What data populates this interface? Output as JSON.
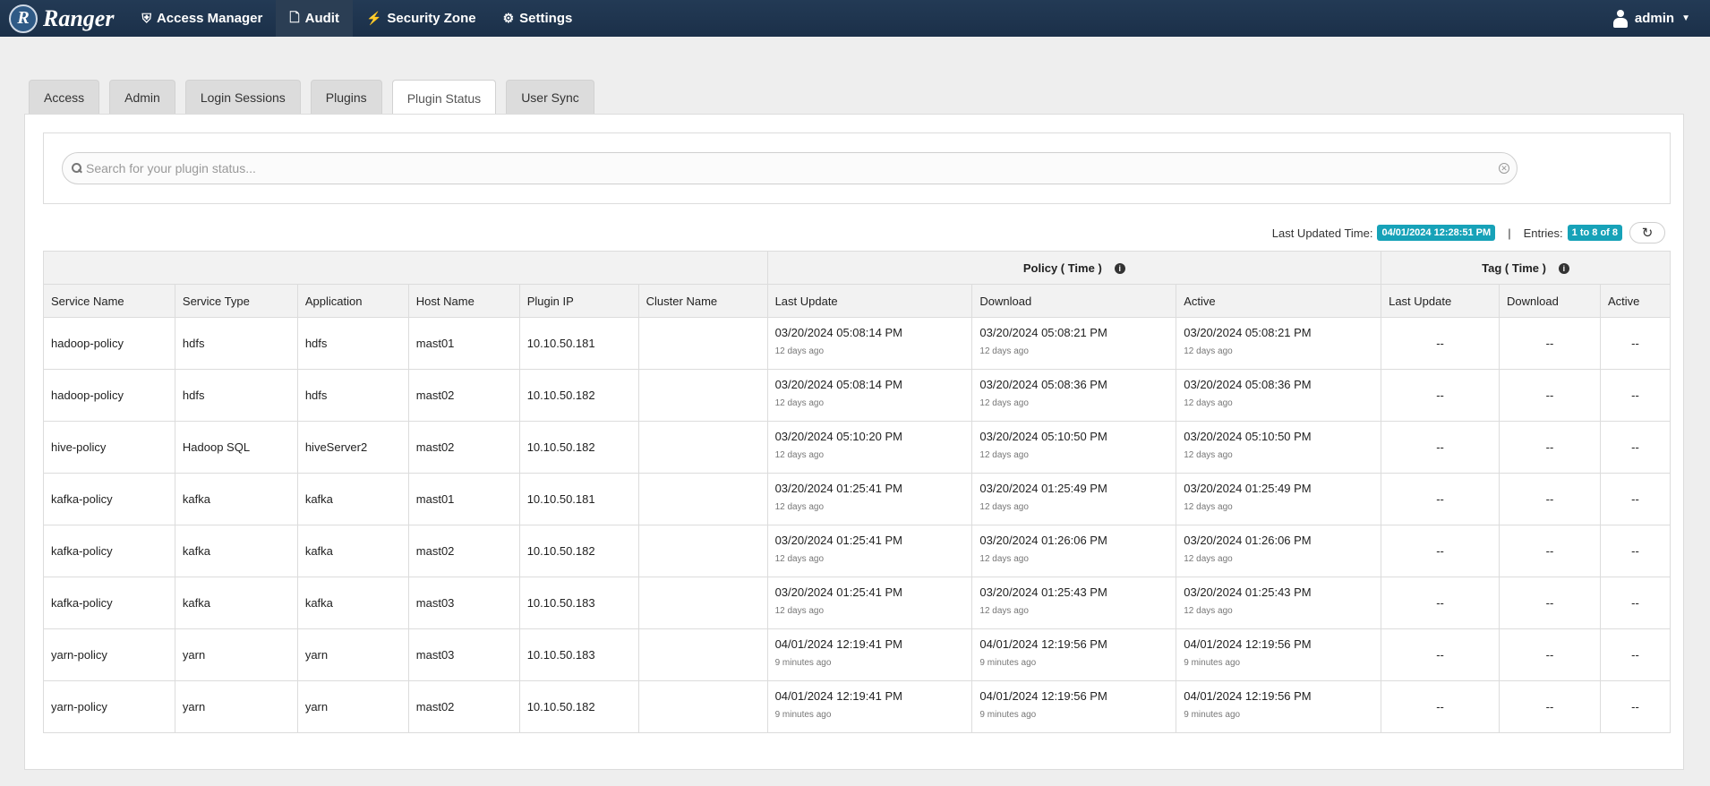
{
  "nav": {
    "brand": "Ranger",
    "brand_logo_letter": "R",
    "items": [
      {
        "label": "Access Manager",
        "icon": "shield-icon"
      },
      {
        "label": "Audit",
        "icon": "file-icon"
      },
      {
        "label": "Security Zone",
        "icon": "bolt-icon"
      },
      {
        "label": "Settings",
        "icon": "gear-icon"
      }
    ],
    "active_item": "Audit",
    "user": "admin"
  },
  "tabs": [
    "Access",
    "Admin",
    "Login Sessions",
    "Plugins",
    "Plugin Status",
    "User Sync"
  ],
  "active_tab": "Plugin Status",
  "search": {
    "placeholder": "Search for your plugin status..."
  },
  "status": {
    "last_updated_label": "Last Updated Time:",
    "last_updated_value": "04/01/2024 12:28:51 PM",
    "separator": "|",
    "entries_label": "Entries:",
    "entries_value": "1 to 8 of 8"
  },
  "table": {
    "group_headers": {
      "policy": "Policy ( Time )",
      "tag": "Tag ( Time )"
    },
    "columns": [
      "Service Name",
      "Service Type",
      "Application",
      "Host Name",
      "Plugin IP",
      "Cluster Name",
      "Last Update",
      "Download",
      "Active",
      "Last Update",
      "Download",
      "Active"
    ],
    "rows": [
      {
        "service_name": "hadoop-policy",
        "service_type": "hdfs",
        "application": "hdfs",
        "host_name": "mast01",
        "plugin_ip": "10.10.50.181",
        "cluster_name": "",
        "policy_last_update": "03/20/2024 05:08:14 PM",
        "policy_last_update_ago": "12 days ago",
        "policy_download": "03/20/2024 05:08:21 PM",
        "policy_download_ago": "12 days ago",
        "policy_active": "03/20/2024 05:08:21 PM",
        "policy_active_ago": "12 days ago",
        "tag_last_update": "--",
        "tag_download": "--",
        "tag_active": "--"
      },
      {
        "service_name": "hadoop-policy",
        "service_type": "hdfs",
        "application": "hdfs",
        "host_name": "mast02",
        "plugin_ip": "10.10.50.182",
        "cluster_name": "",
        "policy_last_update": "03/20/2024 05:08:14 PM",
        "policy_last_update_ago": "12 days ago",
        "policy_download": "03/20/2024 05:08:36 PM",
        "policy_download_ago": "12 days ago",
        "policy_active": "03/20/2024 05:08:36 PM",
        "policy_active_ago": "12 days ago",
        "tag_last_update": "--",
        "tag_download": "--",
        "tag_active": "--"
      },
      {
        "service_name": "hive-policy",
        "service_type": "Hadoop SQL",
        "application": "hiveServer2",
        "host_name": "mast02",
        "plugin_ip": "10.10.50.182",
        "cluster_name": "",
        "policy_last_update": "03/20/2024 05:10:20 PM",
        "policy_last_update_ago": "12 days ago",
        "policy_download": "03/20/2024 05:10:50 PM",
        "policy_download_ago": "12 days ago",
        "policy_active": "03/20/2024 05:10:50 PM",
        "policy_active_ago": "12 days ago",
        "tag_last_update": "--",
        "tag_download": "--",
        "tag_active": "--"
      },
      {
        "service_name": "kafka-policy",
        "service_type": "kafka",
        "application": "kafka",
        "host_name": "mast01",
        "plugin_ip": "10.10.50.181",
        "cluster_name": "",
        "policy_last_update": "03/20/2024 01:25:41 PM",
        "policy_last_update_ago": "12 days ago",
        "policy_download": "03/20/2024 01:25:49 PM",
        "policy_download_ago": "12 days ago",
        "policy_active": "03/20/2024 01:25:49 PM",
        "policy_active_ago": "12 days ago",
        "tag_last_update": "--",
        "tag_download": "--",
        "tag_active": "--"
      },
      {
        "service_name": "kafka-policy",
        "service_type": "kafka",
        "application": "kafka",
        "host_name": "mast02",
        "plugin_ip": "10.10.50.182",
        "cluster_name": "",
        "policy_last_update": "03/20/2024 01:25:41 PM",
        "policy_last_update_ago": "12 days ago",
        "policy_download": "03/20/2024 01:26:06 PM",
        "policy_download_ago": "12 days ago",
        "policy_active": "03/20/2024 01:26:06 PM",
        "policy_active_ago": "12 days ago",
        "tag_last_update": "--",
        "tag_download": "--",
        "tag_active": "--"
      },
      {
        "service_name": "kafka-policy",
        "service_type": "kafka",
        "application": "kafka",
        "host_name": "mast03",
        "plugin_ip": "10.10.50.183",
        "cluster_name": "",
        "policy_last_update": "03/20/2024 01:25:41 PM",
        "policy_last_update_ago": "12 days ago",
        "policy_download": "03/20/2024 01:25:43 PM",
        "policy_download_ago": "12 days ago",
        "policy_active": "03/20/2024 01:25:43 PM",
        "policy_active_ago": "12 days ago",
        "tag_last_update": "--",
        "tag_download": "--",
        "tag_active": "--"
      },
      {
        "service_name": "yarn-policy",
        "service_type": "yarn",
        "application": "yarn",
        "host_name": "mast03",
        "plugin_ip": "10.10.50.183",
        "cluster_name": "",
        "policy_last_update": "04/01/2024 12:19:41 PM",
        "policy_last_update_ago": "9 minutes ago",
        "policy_download": "04/01/2024 12:19:56 PM",
        "policy_download_ago": "9 minutes ago",
        "policy_active": "04/01/2024 12:19:56 PM",
        "policy_active_ago": "9 minutes ago",
        "tag_last_update": "--",
        "tag_download": "--",
        "tag_active": "--"
      },
      {
        "service_name": "yarn-policy",
        "service_type": "yarn",
        "application": "yarn",
        "host_name": "mast02",
        "plugin_ip": "10.10.50.182",
        "cluster_name": "",
        "policy_last_update": "04/01/2024 12:19:41 PM",
        "policy_last_update_ago": "9 minutes ago",
        "policy_download": "04/01/2024 12:19:56 PM",
        "policy_download_ago": "9 minutes ago",
        "policy_active": "04/01/2024 12:19:56 PM",
        "policy_active_ago": "9 minutes ago",
        "tag_last_update": "--",
        "tag_download": "--",
        "tag_active": "--"
      }
    ]
  },
  "colors": {
    "navbar": "#1b3049",
    "badge": "#17a2b8"
  }
}
